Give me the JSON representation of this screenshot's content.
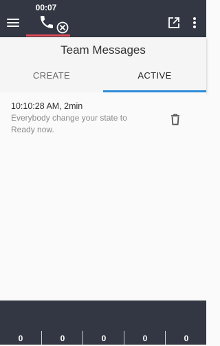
{
  "topbar": {
    "call_timer": "00:07"
  },
  "panel": {
    "title": "Team Messages",
    "tabs": [
      "CREATE",
      "ACTIVE"
    ],
    "active_tab": "ACTIVE"
  },
  "messages": [
    {
      "time": "10:10:28 AM, 2min",
      "text": "Everybody change your state to Ready now."
    }
  ],
  "footer": {
    "counters": [
      "0",
      "0",
      "0",
      "0",
      "0"
    ]
  },
  "colors": {
    "topbar_bg": "#323743",
    "call_underline": "#e04c59",
    "active_tab_indicator": "#2c8ad8"
  }
}
